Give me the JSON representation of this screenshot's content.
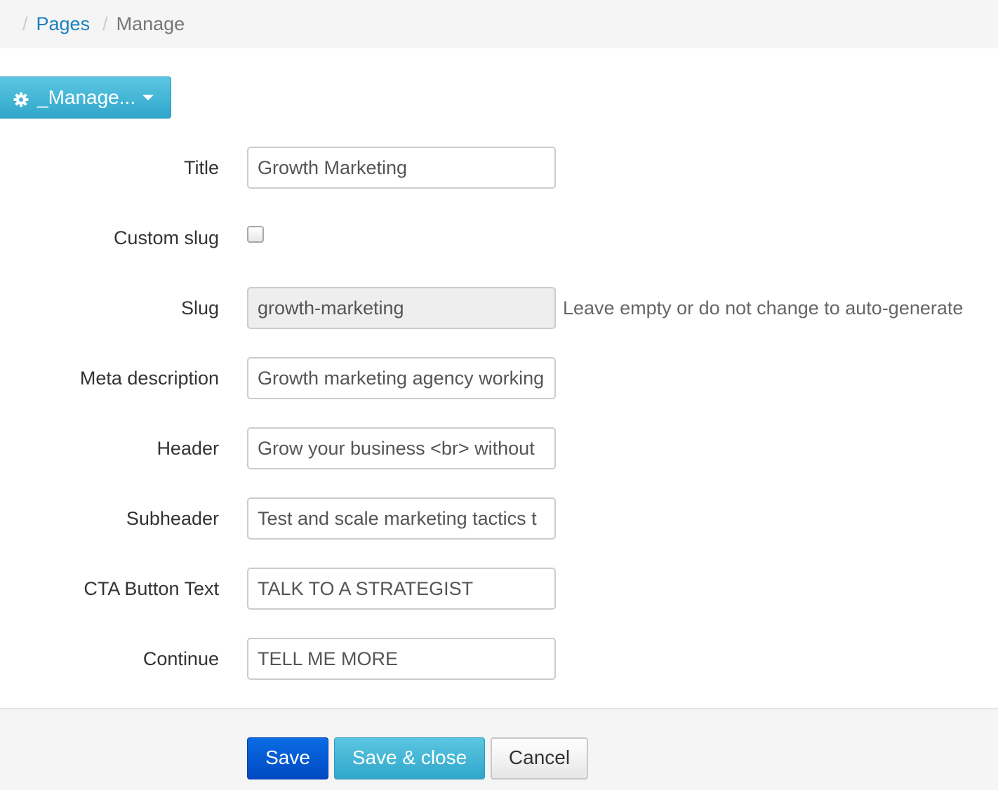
{
  "breadcrumb": {
    "items": [
      {
        "label": "Pages",
        "link": true
      },
      {
        "label": "Manage",
        "link": false
      }
    ]
  },
  "actions_menu": {
    "label": "_Manage...",
    "icon": "gear-icon"
  },
  "form": {
    "title": {
      "label": "Title",
      "value": "Growth Marketing"
    },
    "custom_slug": {
      "label": "Custom slug",
      "checked": false
    },
    "slug": {
      "label": "Slug",
      "value": "growth-marketing",
      "help": "Leave empty or do not change to auto-generate"
    },
    "meta_description": {
      "label": "Meta description",
      "value": "Growth marketing agency working"
    },
    "header": {
      "label": "Header",
      "value": "Grow your business <br> without"
    },
    "subheader": {
      "label": "Subheader",
      "value": "Test and scale marketing tactics t"
    },
    "cta_button_text": {
      "label": "CTA Button Text",
      "value": "TALK TO A STRATEGIST"
    },
    "continue": {
      "label": "Continue",
      "value": "TELL ME MORE"
    }
  },
  "footer": {
    "save_label": "Save",
    "save_close_label": "Save & close",
    "cancel_label": "Cancel"
  },
  "colors": {
    "link": "#1a7fc1",
    "primary": "#0055d4",
    "info": "#46b8da"
  }
}
